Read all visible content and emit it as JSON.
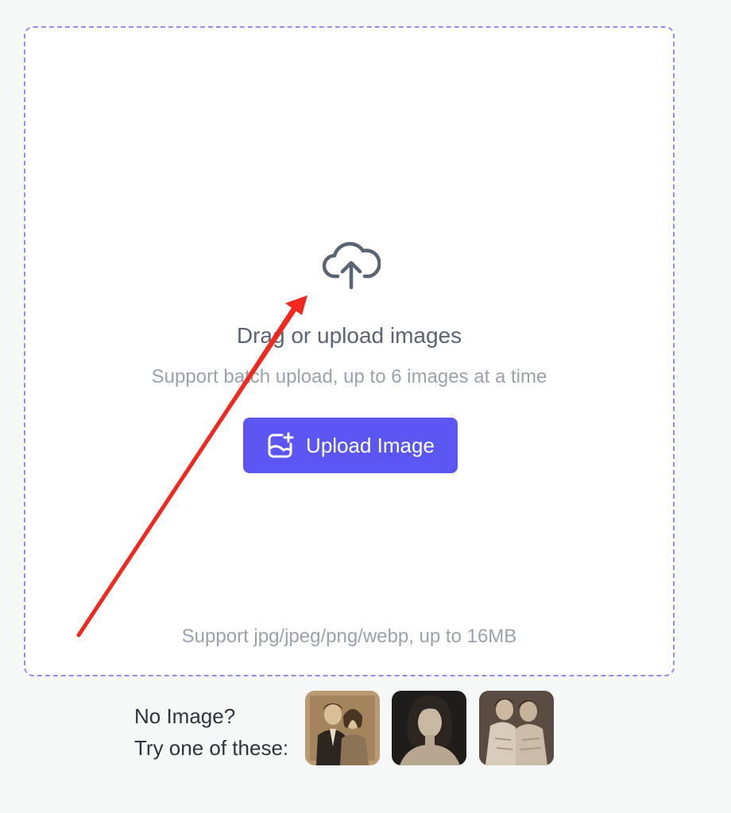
{
  "dropzone": {
    "icon": "cloud-upload-icon",
    "title": "Drag or upload images",
    "subtitle": "Support batch upload, up to 6 images at a time",
    "upload_button": {
      "label": "Upload Image",
      "icon": "image-add-icon"
    },
    "formats_note": "Support jpg/jpeg/png/webp, up to 16MB"
  },
  "samples": {
    "label_line1": "No Image?",
    "label_line2": "Try one of these:",
    "thumbnails": [
      {
        "description": "vintage couple photo"
      },
      {
        "description": "vintage woman portrait"
      },
      {
        "description": "vintage two women photo"
      }
    ]
  },
  "colors": {
    "accent": "#5b55f2",
    "dropzone_border": "#8f8df0",
    "annotation_arrow": "#f0281e"
  }
}
